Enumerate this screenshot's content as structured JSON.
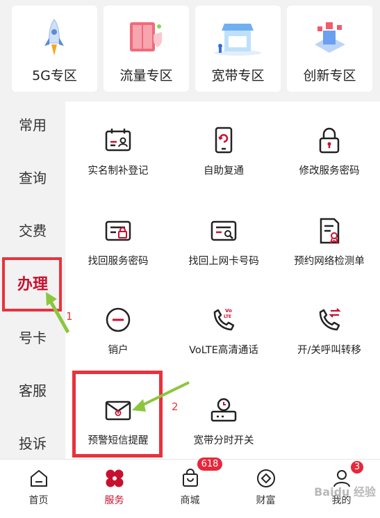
{
  "zones": [
    {
      "label": "5G专区",
      "icon": "rocket-icon"
    },
    {
      "label": "流量专区",
      "icon": "data-cabinet-icon"
    },
    {
      "label": "宽带专区",
      "icon": "storefront-icon"
    },
    {
      "label": "创新专区",
      "icon": "innovation-blocks-icon"
    }
  ],
  "sidebar": {
    "items": [
      "常用",
      "查询",
      "交费",
      "办理",
      "号卡",
      "客服",
      "投诉"
    ],
    "active": "办理"
  },
  "services": [
    {
      "label": "实名制补登记",
      "icon": "id-card-icon"
    },
    {
      "label": "自助复通",
      "icon": "phone-restore-icon"
    },
    {
      "label": "修改服务密码",
      "icon": "lock-icon"
    },
    {
      "label": "找回服务密码",
      "icon": "password-card-icon"
    },
    {
      "label": "找回上网卡号码",
      "icon": "network-card-icon"
    },
    {
      "label": "预约网络检测单",
      "icon": "document-check-icon"
    },
    {
      "label": "销户",
      "icon": "minus-circle-icon"
    },
    {
      "label": "VoLTE高清通话",
      "icon": "volte-phone-icon"
    },
    {
      "label": "开/关呼叫转移",
      "icon": "call-forward-icon"
    },
    {
      "label": "预警短信提醒",
      "icon": "warning-envelope-icon"
    },
    {
      "label": "宽带分时开关",
      "icon": "router-timer-icon"
    }
  ],
  "annotations": {
    "mark1": "1",
    "mark2": "2"
  },
  "nav": {
    "items": [
      {
        "label": "首页",
        "icon": "home-icon"
      },
      {
        "label": "服务",
        "icon": "service-flower-icon"
      },
      {
        "label": "商城",
        "icon": "shopping-bag-icon"
      },
      {
        "label": "财富",
        "icon": "wealth-diamond-icon"
      },
      {
        "label": "我的",
        "icon": "profile-icon"
      }
    ],
    "active": "服务",
    "mall_badge": "618",
    "mine_badge": "3"
  },
  "watermark": "Baidu 经验",
  "colors": {
    "brand": "#c8102e",
    "annotation": "#e8323c",
    "arrow": "#8cc63f"
  }
}
